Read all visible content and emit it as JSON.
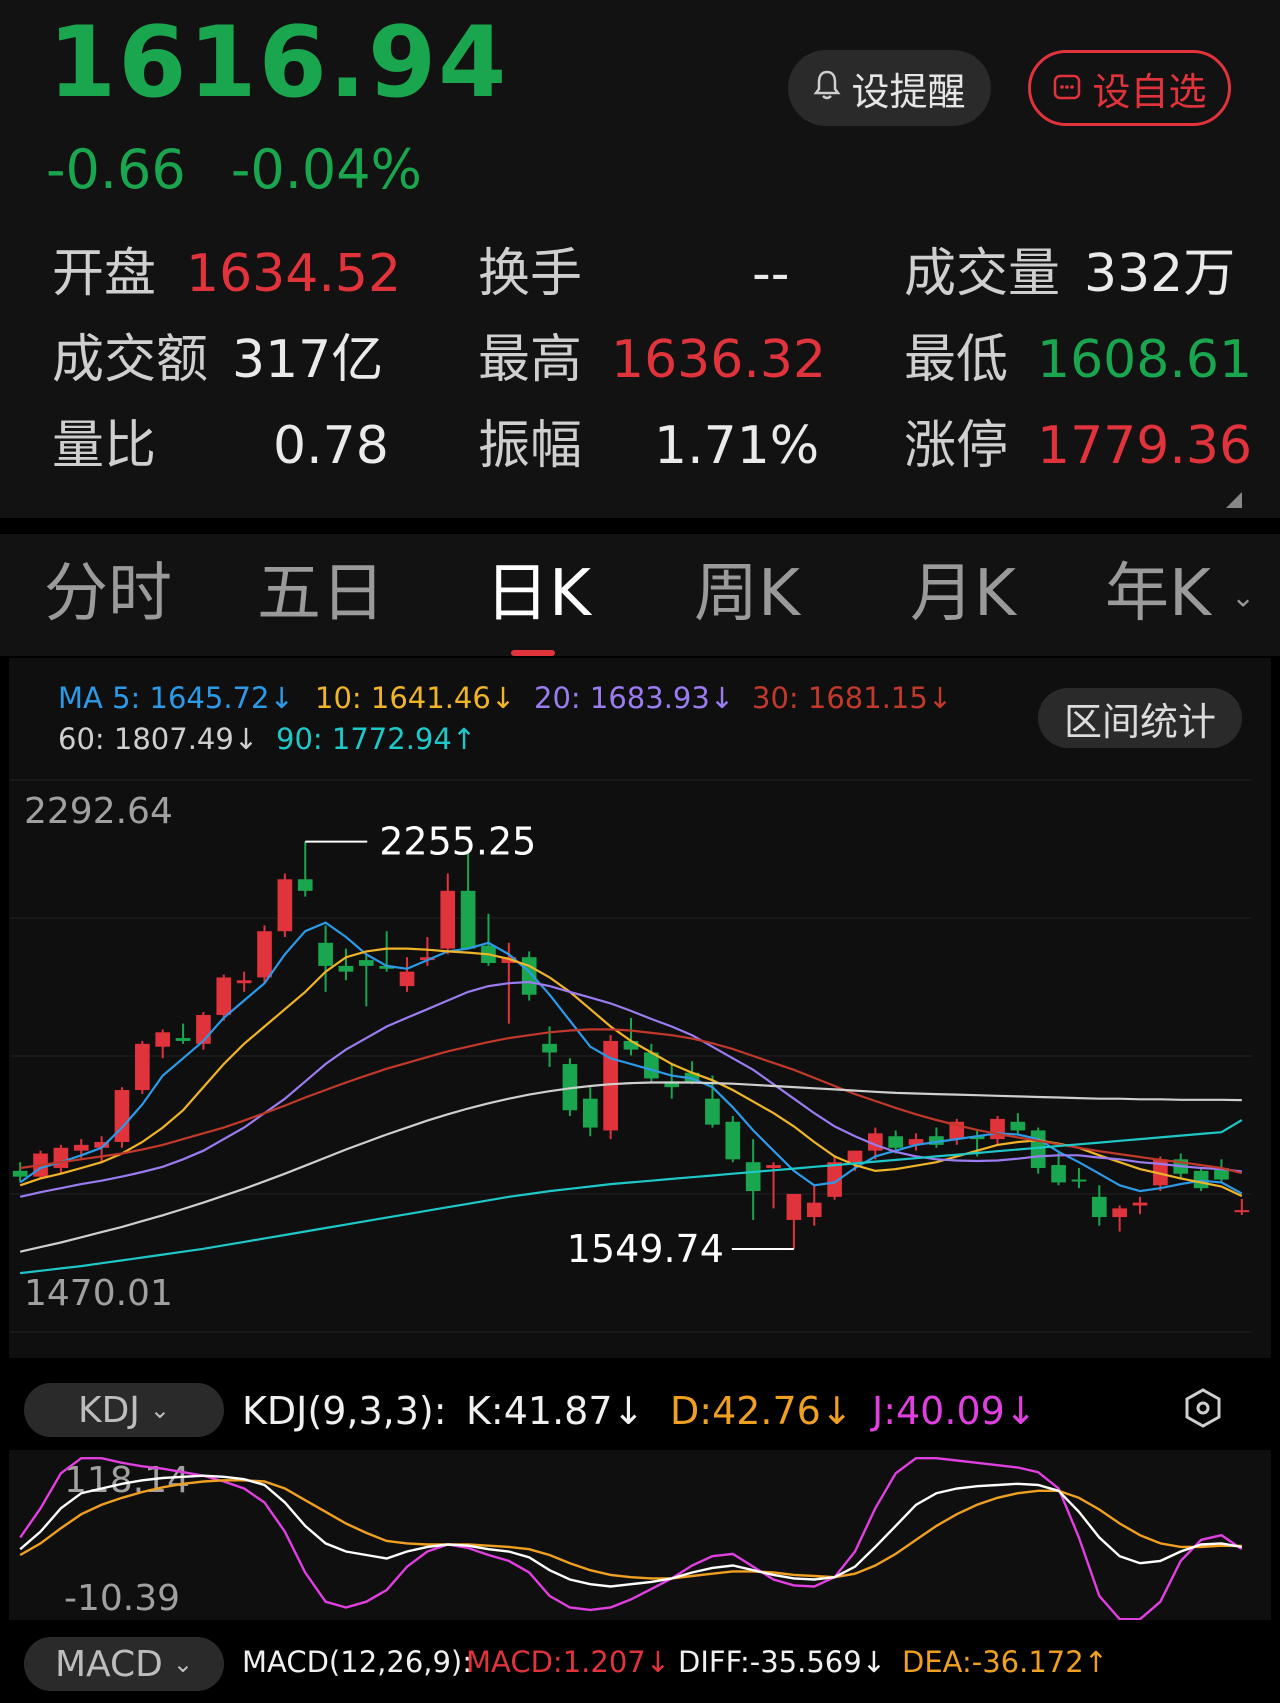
{
  "quote": {
    "price": "1616.94",
    "change": "-0.66",
    "change_pct": "-0.04%",
    "alert_label": "设提醒",
    "watchlist_label": "设自选"
  },
  "stats": {
    "open_label": "开盘",
    "open_value": "1634.52",
    "turnover_label": "换手",
    "turnover_value": "--",
    "volume_label": "成交量",
    "volume_value": "332万",
    "amount_label": "成交额",
    "amount_value": "317亿",
    "high_label": "最高",
    "high_value": "1636.32",
    "low_label": "最低",
    "low_value": "1608.61",
    "vol_ratio_label": "量比",
    "vol_ratio_value": "0.78",
    "amplitude_label": "振幅",
    "amplitude_value": "1.71%",
    "limit_up_label": "涨停",
    "limit_up_value": "1779.36"
  },
  "tabs": {
    "intraday": "分时",
    "five_day": "五日",
    "daily_k": "日K",
    "weekly_k": "周K",
    "monthly_k": "月K",
    "yearly_k": "年K",
    "active": "日K"
  },
  "ma": {
    "ma5": "MA 5: 1645.72↓",
    "ma10": "10: 1641.46↓",
    "ma20": "20: 1683.93↓",
    "ma30": "30: 1681.15↓",
    "ma60": "60: 1807.49↓",
    "ma90": "90: 1772.94↑",
    "range_stats_button": "区间统计"
  },
  "chart_labels": {
    "axis_high": "2292.64",
    "axis_low": "1470.01",
    "peak_marker": "2255.25",
    "trough_marker": "1549.74"
  },
  "kdj": {
    "selector": "KDJ",
    "params": "KDJ(9,3,3):",
    "k": "K:41.87↓",
    "d": "D:42.76↓",
    "j": "J:40.09↓",
    "axis_high": "118.14",
    "axis_low": "-10.39"
  },
  "macd": {
    "selector": "MACD",
    "params": "MACD(12,26,9):",
    "macd": "MACD:1.207↓",
    "diff": "DIFF:-35.569↓",
    "dea": "DEA:-36.172↑"
  },
  "colors": {
    "up": "#e1333c",
    "down": "#1aa64e",
    "ma5": "#2d9ae8",
    "ma10": "#f0b429",
    "ma20": "#9b7cf0",
    "ma30": "#c0392b",
    "ma60": "#cfcfcf",
    "ma90": "#1fc8c8",
    "kdj_k": "#ffffff",
    "kdj_d": "#f0a020",
    "kdj_j": "#e040e0"
  },
  "chart_data": {
    "type": "candlestick",
    "ylim": [
      1470.01,
      2292.64
    ],
    "candles": [
      {
        "o": 1685,
        "h": 1700,
        "l": 1665,
        "c": 1675
      },
      {
        "o": 1675,
        "h": 1720,
        "l": 1670,
        "c": 1715
      },
      {
        "o": 1690,
        "h": 1730,
        "l": 1680,
        "c": 1725
      },
      {
        "o": 1720,
        "h": 1740,
        "l": 1705,
        "c": 1730
      },
      {
        "o": 1725,
        "h": 1745,
        "l": 1700,
        "c": 1735
      },
      {
        "o": 1735,
        "h": 1830,
        "l": 1725,
        "c": 1825
      },
      {
        "o": 1825,
        "h": 1910,
        "l": 1818,
        "c": 1905
      },
      {
        "o": 1900,
        "h": 1930,
        "l": 1880,
        "c": 1925
      },
      {
        "o": 1915,
        "h": 1940,
        "l": 1905,
        "c": 1910
      },
      {
        "o": 1905,
        "h": 1960,
        "l": 1895,
        "c": 1955
      },
      {
        "o": 1955,
        "h": 2025,
        "l": 1945,
        "c": 2020
      },
      {
        "o": 2010,
        "h": 2030,
        "l": 1995,
        "c": 2015
      },
      {
        "o": 2020,
        "h": 2110,
        "l": 2010,
        "c": 2100
      },
      {
        "o": 2100,
        "h": 2200,
        "l": 2090,
        "c": 2190
      },
      {
        "o": 2190,
        "h": 2255.25,
        "l": 2160,
        "c": 2170
      },
      {
        "o": 2080,
        "h": 2110,
        "l": 1995,
        "c": 2040
      },
      {
        "o": 2040,
        "h": 2070,
        "l": 2015,
        "c": 2030
      },
      {
        "o": 2050,
        "h": 2060,
        "l": 1970,
        "c": 2040
      },
      {
        "o": 2040,
        "h": 2100,
        "l": 2030,
        "c": 2035
      },
      {
        "o": 2005,
        "h": 2055,
        "l": 1995,
        "c": 2030
      },
      {
        "o": 2050,
        "h": 2090,
        "l": 2040,
        "c": 2055
      },
      {
        "o": 2070,
        "h": 2200,
        "l": 2060,
        "c": 2170
      },
      {
        "o": 2170,
        "h": 2240,
        "l": 2070,
        "c": 2070
      },
      {
        "o": 2075,
        "h": 2130,
        "l": 2040,
        "c": 2045
      },
      {
        "o": 2045,
        "h": 2080,
        "l": 1940,
        "c": 2055
      },
      {
        "o": 2055,
        "h": 2065,
        "l": 1980,
        "c": 1990
      },
      {
        "o": 1905,
        "h": 1935,
        "l": 1865,
        "c": 1890
      },
      {
        "o": 1870,
        "h": 1880,
        "l": 1780,
        "c": 1790
      },
      {
        "o": 1810,
        "h": 1830,
        "l": 1745,
        "c": 1760
      },
      {
        "o": 1755,
        "h": 1920,
        "l": 1740,
        "c": 1910
      },
      {
        "o": 1910,
        "h": 1950,
        "l": 1885,
        "c": 1895
      },
      {
        "o": 1890,
        "h": 1905,
        "l": 1840,
        "c": 1845
      },
      {
        "o": 1840,
        "h": 1870,
        "l": 1810,
        "c": 1830
      },
      {
        "o": 1855,
        "h": 1875,
        "l": 1835,
        "c": 1840
      },
      {
        "o": 1810,
        "h": 1850,
        "l": 1760,
        "c": 1765
      },
      {
        "o": 1770,
        "h": 1780,
        "l": 1700,
        "c": 1705
      },
      {
        "o": 1700,
        "h": 1740,
        "l": 1600,
        "c": 1650
      },
      {
        "o": 1690,
        "h": 1700,
        "l": 1620,
        "c": 1695
      },
      {
        "o": 1600,
        "h": 1645,
        "l": 1549.74,
        "c": 1645
      },
      {
        "o": 1605,
        "h": 1660,
        "l": 1590,
        "c": 1630
      },
      {
        "o": 1640,
        "h": 1710,
        "l": 1635,
        "c": 1700
      },
      {
        "o": 1700,
        "h": 1720,
        "l": 1685,
        "c": 1720
      },
      {
        "o": 1720,
        "h": 1760,
        "l": 1705,
        "c": 1750
      },
      {
        "o": 1745,
        "h": 1755,
        "l": 1715,
        "c": 1725
      },
      {
        "o": 1730,
        "h": 1750,
        "l": 1720,
        "c": 1740
      },
      {
        "o": 1745,
        "h": 1760,
        "l": 1725,
        "c": 1730
      },
      {
        "o": 1740,
        "h": 1775,
        "l": 1730,
        "c": 1770
      },
      {
        "o": 1745,
        "h": 1755,
        "l": 1710,
        "c": 1740
      },
      {
        "o": 1740,
        "h": 1780,
        "l": 1730,
        "c": 1775
      },
      {
        "o": 1770,
        "h": 1785,
        "l": 1750,
        "c": 1755
      },
      {
        "o": 1755,
        "h": 1760,
        "l": 1680,
        "c": 1690
      },
      {
        "o": 1695,
        "h": 1720,
        "l": 1660,
        "c": 1665
      },
      {
        "o": 1670,
        "h": 1690,
        "l": 1655,
        "c": 1668
      },
      {
        "o": 1640,
        "h": 1660,
        "l": 1590,
        "c": 1605
      },
      {
        "o": 1605,
        "h": 1625,
        "l": 1580,
        "c": 1620
      },
      {
        "o": 1625,
        "h": 1640,
        "l": 1610,
        "c": 1630
      },
      {
        "o": 1660,
        "h": 1710,
        "l": 1650,
        "c": 1705
      },
      {
        "o": 1705,
        "h": 1715,
        "l": 1670,
        "c": 1680
      },
      {
        "o": 1685,
        "h": 1690,
        "l": 1650,
        "c": 1655
      },
      {
        "o": 1690,
        "h": 1705,
        "l": 1665,
        "c": 1670
      },
      {
        "o": 1615,
        "h": 1636.32,
        "l": 1608.61,
        "c": 1616.94
      }
    ],
    "series": [
      {
        "name": "MA 5",
        "values": [
          1665,
          1690,
          1700,
          1712,
          1725,
          1760,
          1800,
          1850,
          1880,
          1910,
          1950,
          1980,
          2010,
          2060,
          2100,
          2115,
          2090,
          2060,
          2040,
          2035,
          2050,
          2065,
          2070,
          2080,
          2060,
          2030,
          1990,
          1945,
          1900,
          1880,
          1870,
          1860,
          1850,
          1845,
          1830,
          1795,
          1755,
          1720,
          1685,
          1660,
          1665,
          1690,
          1710,
          1720,
          1730,
          1735,
          1740,
          1745,
          1750,
          1748,
          1740,
          1718,
          1700,
          1680,
          1660,
          1650,
          1655,
          1662,
          1668,
          1665,
          1645.72
        ]
      },
      {
        "name": "10",
        "values": [
          1660,
          1672,
          1680,
          1690,
          1700,
          1715,
          1735,
          1760,
          1790,
          1830,
          1870,
          1905,
          1935,
          1965,
          1995,
          2030,
          2055,
          2065,
          2070,
          2070,
          2068,
          2065,
          2063,
          2060,
          2052,
          2040,
          2020,
          1995,
          1965,
          1935,
          1910,
          1890,
          1870,
          1855,
          1842,
          1825,
          1805,
          1785,
          1762,
          1735,
          1710,
          1695,
          1685,
          1688,
          1694,
          1700,
          1710,
          1720,
          1730,
          1735,
          1738,
          1732,
          1725,
          1712,
          1700,
          1688,
          1680,
          1672,
          1665,
          1658,
          1641.46
        ]
      },
      {
        "name": "20",
        "values": [
          1640,
          1648,
          1655,
          1662,
          1668,
          1675,
          1683,
          1692,
          1705,
          1720,
          1740,
          1760,
          1785,
          1810,
          1840,
          1870,
          1895,
          1915,
          1935,
          1950,
          1965,
          1980,
          1995,
          2005,
          2010,
          2012,
          2005,
          1995,
          1985,
          1975,
          1962,
          1948,
          1935,
          1920,
          1900,
          1880,
          1860,
          1835,
          1810,
          1785,
          1762,
          1745,
          1730,
          1718,
          1710,
          1705,
          1703,
          1702,
          1703,
          1706,
          1710,
          1712,
          1712,
          1708,
          1705,
          1700,
          1697,
          1693,
          1690,
          1688,
          1683.93
        ]
      },
      {
        "name": "30",
        "values": [
          1690,
          1695,
          1700,
          1705,
          1710,
          1715,
          1722,
          1730,
          1740,
          1750,
          1760,
          1772,
          1785,
          1798,
          1812,
          1825,
          1838,
          1850,
          1862,
          1872,
          1882,
          1892,
          1900,
          1908,
          1915,
          1920,
          1925,
          1928,
          1930,
          1930,
          1928,
          1924,
          1920,
          1914,
          1906,
          1896,
          1884,
          1872,
          1860,
          1846,
          1832,
          1818,
          1806,
          1794,
          1783,
          1773,
          1764,
          1756,
          1749,
          1743,
          1737,
          1731,
          1725,
          1719,
          1714,
          1709,
          1704,
          1700,
          1695,
          1690,
          1681.15
        ]
      },
      {
        "name": "60",
        "values": [
          1545,
          1553,
          1561,
          1570,
          1579,
          1588,
          1598,
          1608,
          1619,
          1630,
          1642,
          1654,
          1667,
          1680,
          1694,
          1708,
          1722,
          1735,
          1748,
          1760,
          1772,
          1783,
          1793,
          1802,
          1810,
          1817,
          1823,
          1828,
          1832,
          1835,
          1837,
          1838,
          1838,
          1838,
          1837,
          1836,
          1834,
          1832,
          1830,
          1828,
          1826,
          1824,
          1822,
          1820,
          1819,
          1818,
          1817,
          1816,
          1815,
          1814,
          1813,
          1812,
          1811,
          1810,
          1810,
          1809,
          1809,
          1808,
          1808,
          1808,
          1807.49
        ]
      },
      {
        "name": "90",
        "values": [
          1508,
          1512,
          1516,
          1520,
          1525,
          1530,
          1535,
          1540,
          1545,
          1550,
          1556,
          1562,
          1568,
          1574,
          1580,
          1586,
          1592,
          1598,
          1604,
          1610,
          1616,
          1622,
          1628,
          1634,
          1640,
          1645,
          1650,
          1654,
          1658,
          1662,
          1665,
          1668,
          1671,
          1674,
          1677,
          1680,
          1683,
          1686,
          1689,
          1692,
          1695,
          1698,
          1701,
          1704,
          1707,
          1710,
          1713,
          1716,
          1719,
          1722,
          1725,
          1728,
          1731,
          1734,
          1737,
          1740,
          1743,
          1746,
          1749,
          1752,
          1772.94
        ]
      }
    ],
    "kdj": {
      "ylim": [
        -10.39,
        118.14
      ],
      "K": [
        40,
        55,
        75,
        88,
        92,
        96,
        99,
        101,
        102,
        103,
        102,
        100,
        95,
        80,
        60,
        45,
        38,
        35,
        32,
        38,
        42,
        44,
        43,
        40,
        38,
        33,
        22,
        14,
        10,
        8,
        10,
        12,
        15,
        20,
        24,
        26,
        22,
        18,
        15,
        14,
        16,
        25,
        42,
        60,
        78,
        88,
        92,
        94,
        95,
        96,
        95,
        90,
        72,
        50,
        34,
        28,
        30,
        38,
        44,
        45,
        41.87
      ],
      "D": [
        35,
        45,
        58,
        70,
        78,
        84,
        89,
        93,
        96,
        98,
        99,
        99,
        98,
        92,
        82,
        72,
        62,
        54,
        47,
        45,
        44,
        44,
        44,
        43,
        42,
        40,
        35,
        28,
        22,
        18,
        16,
        15,
        15,
        17,
        19,
        21,
        21,
        20,
        18,
        17,
        16,
        19,
        26,
        36,
        48,
        60,
        70,
        78,
        84,
        88,
        90,
        90,
        84,
        74,
        62,
        52,
        45,
        42,
        42,
        43,
        42.76
      ],
      "J": [
        50,
        75,
        105,
        118,
        118,
        114,
        111,
        109,
        106,
        103,
        98,
        92,
        80,
        55,
        20,
        -5,
        -10,
        -5,
        5,
        25,
        38,
        44,
        41,
        35,
        30,
        20,
        0,
        -10,
        -12,
        -10,
        -3,
        6,
        15,
        26,
        34,
        36,
        25,
        14,
        9,
        8,
        16,
        38,
        75,
        105,
        118,
        118,
        116,
        114,
        112,
        110,
        106,
        92,
        50,
        0,
        -20,
        -20,
        -5,
        30,
        48,
        52,
        40.09
      ]
    }
  }
}
